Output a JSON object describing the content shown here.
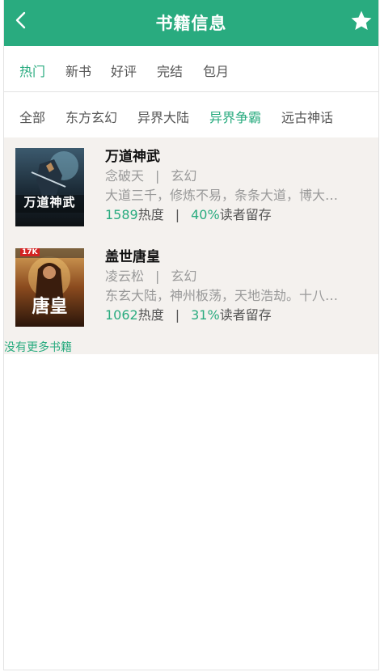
{
  "header": {
    "title": "书籍信息",
    "back_icon": "chevron-left-icon",
    "favorite_icon": "star-icon",
    "color": "#29ab7f"
  },
  "tabs_primary": [
    {
      "label": "热门",
      "active": true
    },
    {
      "label": "新书",
      "active": false
    },
    {
      "label": "好评",
      "active": false
    },
    {
      "label": "完结",
      "active": false
    },
    {
      "label": "包月",
      "active": false
    }
  ],
  "tabs_secondary": [
    {
      "label": "全部",
      "active": false
    },
    {
      "label": "东方玄幻",
      "active": false
    },
    {
      "label": "异界大陆",
      "active": false
    },
    {
      "label": "异界争霸",
      "active": true
    },
    {
      "label": "远古神话",
      "active": false
    }
  ],
  "books": [
    {
      "title": "万道神武",
      "author": "念破天",
      "separator": "|",
      "genre": "玄幻",
      "summary": "大道三千，修炼不易，条条大道，博大…",
      "heat": "1589",
      "heat_label": "热度",
      "retention": "40%",
      "retention_label": "读者留存",
      "cover_text": "万道神武"
    },
    {
      "title": "盖世唐皇",
      "author": "凌云松",
      "separator": "|",
      "genre": "玄幻",
      "summary": "东玄大陆，神州板荡，天地浩劫。十八…",
      "heat": "1062",
      "heat_label": "热度",
      "retention": "31%",
      "retention_label": "读者留存",
      "cover_text": "唐皇",
      "cover_badge": "17K"
    }
  ],
  "footer": {
    "no_more": "没有更多书籍"
  }
}
